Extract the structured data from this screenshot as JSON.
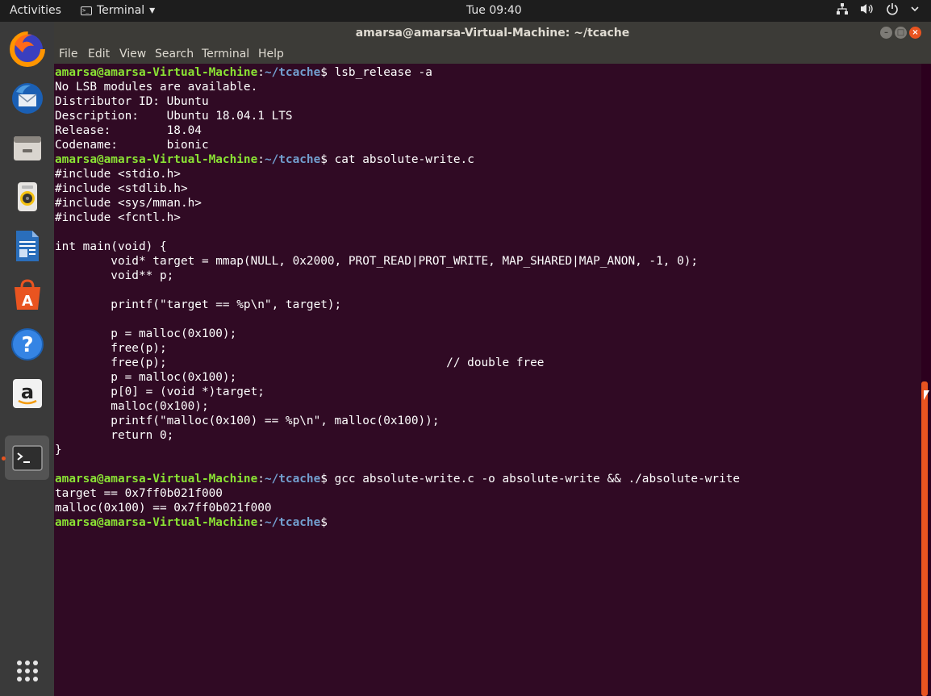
{
  "topbar": {
    "activities": "Activities",
    "app_name": "Terminal",
    "app_arrow": "▾",
    "clock": "Tue 09:40",
    "tray_icons": [
      "network-icon",
      "volume-icon",
      "power-icon",
      "chevron-down-icon"
    ]
  },
  "dock": {
    "items": [
      {
        "name": "firefox",
        "icon": "firefox-icon"
      },
      {
        "name": "thunderbird",
        "icon": "thunderbird-icon"
      },
      {
        "name": "files",
        "icon": "files-icon"
      },
      {
        "name": "rhythmbox",
        "icon": "rhythmbox-icon"
      },
      {
        "name": "libreoffice-writer",
        "icon": "writer-icon"
      },
      {
        "name": "ubuntu-software",
        "icon": "software-icon"
      },
      {
        "name": "help",
        "icon": "help-icon",
        "glyph": "?"
      },
      {
        "name": "amazon",
        "icon": "amazon-icon",
        "glyph": "a"
      },
      {
        "name": "terminal",
        "icon": "terminal-icon",
        "active": true
      },
      {
        "name": "show-applications",
        "icon": "app-grid-icon"
      }
    ]
  },
  "window": {
    "title": "amarsa@amarsa-Virtual-Machine: ~/tcache",
    "controls": {
      "minimize": "–",
      "maximize": "□",
      "close": "×"
    },
    "menu": [
      "File",
      "Edit",
      "View",
      "Search",
      "Terminal",
      "Help"
    ]
  },
  "terminal": {
    "prompt_user": "amarsa@amarsa-Virtual-Machine",
    "prompt_sep": ":",
    "prompt_path": "~/tcache",
    "prompt_end": "$ ",
    "lines": [
      {
        "type": "prompt",
        "cmd": "lsb_release -a"
      },
      {
        "type": "out",
        "text": "No LSB modules are available."
      },
      {
        "type": "out",
        "text": "Distributor ID:\tUbuntu"
      },
      {
        "type": "out",
        "text": "Description:\tUbuntu 18.04.1 LTS"
      },
      {
        "type": "out",
        "text": "Release:\t18.04"
      },
      {
        "type": "out",
        "text": "Codename:\tbionic"
      },
      {
        "type": "prompt",
        "cmd": "cat absolute-write.c"
      },
      {
        "type": "out",
        "text": "#include <stdio.h>"
      },
      {
        "type": "out",
        "text": "#include <stdlib.h>"
      },
      {
        "type": "out",
        "text": "#include <sys/mman.h>"
      },
      {
        "type": "out",
        "text": "#include <fcntl.h>"
      },
      {
        "type": "out",
        "text": ""
      },
      {
        "type": "out",
        "text": "int main(void) {"
      },
      {
        "type": "out",
        "text": "\tvoid* target = mmap(NULL, 0x2000, PROT_READ|PROT_WRITE, MAP_SHARED|MAP_ANON, -1, 0);"
      },
      {
        "type": "out",
        "text": "\tvoid** p;"
      },
      {
        "type": "out",
        "text": ""
      },
      {
        "type": "out",
        "text": "\tprintf(\"target == %p\\n\", target);"
      },
      {
        "type": "out",
        "text": ""
      },
      {
        "type": "out",
        "text": "\tp = malloc(0x100);"
      },
      {
        "type": "out",
        "text": "\tfree(p);"
      },
      {
        "type": "out",
        "text": "\tfree(p);\t\t\t\t\t// double free"
      },
      {
        "type": "out",
        "text": "\tp = malloc(0x100);"
      },
      {
        "type": "out",
        "text": "\tp[0] = (void *)target;"
      },
      {
        "type": "out",
        "text": "\tmalloc(0x100);"
      },
      {
        "type": "out",
        "text": "\tprintf(\"malloc(0x100) == %p\\n\", malloc(0x100));"
      },
      {
        "type": "out",
        "text": "\treturn 0;"
      },
      {
        "type": "out",
        "text": "}"
      },
      {
        "type": "out",
        "text": ""
      },
      {
        "type": "prompt",
        "cmd": "gcc absolute-write.c -o absolute-write && ./absolute-write"
      },
      {
        "type": "out",
        "text": "target == 0x7ff0b021f000"
      },
      {
        "type": "out",
        "text": "malloc(0x100) == 0x7ff0b021f000"
      },
      {
        "type": "prompt",
        "cmd": ""
      }
    ]
  },
  "colors": {
    "terminal_bg": "#300a24",
    "prompt_user": "#8ae234",
    "prompt_path": "#729fcf",
    "accent": "#e95420"
  }
}
